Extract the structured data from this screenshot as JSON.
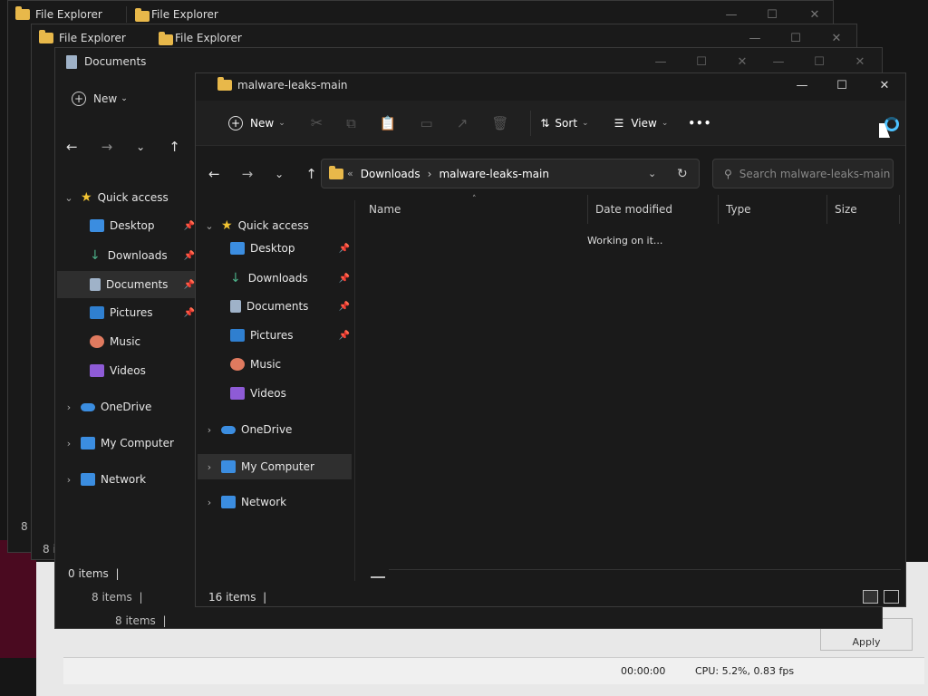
{
  "back_windows": {
    "w1": {
      "title": "File Explorer",
      "title2": "File Explorer",
      "status": "8 items"
    },
    "w2": {
      "title": "File Explorer",
      "title2": "File Explorer",
      "status": "8 items"
    },
    "w3": {
      "title": "Documents",
      "status": "0 items",
      "status_outer": "8 items",
      "new_label": "New",
      "sidebar": [
        {
          "label": "Quick access"
        },
        {
          "label": "Desktop"
        },
        {
          "label": "Downloads"
        },
        {
          "label": "Documents"
        },
        {
          "label": "Pictures"
        },
        {
          "label": "Music"
        },
        {
          "label": "Videos"
        },
        {
          "label": "OneDrive"
        },
        {
          "label": "My Computer"
        },
        {
          "label": "Network"
        }
      ]
    }
  },
  "main": {
    "title": "malware-leaks-main",
    "toolbar": {
      "new_label": "New",
      "sort_label": "Sort",
      "view_label": "View",
      "more_label": "•••"
    },
    "breadcrumb": [
      "Downloads",
      "malware-leaks-main"
    ],
    "breadcrumb_prefix": "«",
    "search_placeholder": "Search malware-leaks-main",
    "columns": [
      "Name",
      "Date modified",
      "Type",
      "Size"
    ],
    "working_text": "Working on it...",
    "sidebar": [
      {
        "label": "Quick access"
      },
      {
        "label": "Desktop"
      },
      {
        "label": "Downloads"
      },
      {
        "label": "Documents"
      },
      {
        "label": "Pictures"
      },
      {
        "label": "Music"
      },
      {
        "label": "Videos"
      },
      {
        "label": "OneDrive"
      },
      {
        "label": "My Computer"
      },
      {
        "label": "Network"
      }
    ],
    "status": "16 items"
  },
  "background_app": {
    "time": "00:00:00",
    "cpu": "CPU: 5.2%, 0.83 fps",
    "apply_label": "Apply"
  },
  "colors": {
    "accent": "#4cc2ff",
    "folder": "#e8b84a",
    "onedrive": "#3b8de0",
    "music": "#e07a5f",
    "videos": "#8e5bd6",
    "star": "#f3c432",
    "download": "#4caf88"
  }
}
